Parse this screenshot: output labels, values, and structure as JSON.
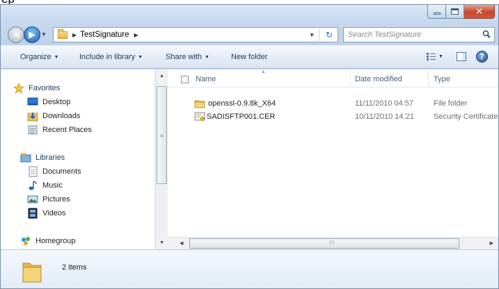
{
  "window": {
    "title": "TestSignature",
    "caption_buttons": [
      "minimize",
      "maximize",
      "close"
    ]
  },
  "address": {
    "crumbs": [
      "TestSignature"
    ],
    "folder_icon": "folder-icon"
  },
  "search": {
    "placeholder": "Search TestSignature"
  },
  "commandbar": {
    "organize": "Organize",
    "include_in_library": "Include in library",
    "share_with": "Share with",
    "new_folder": "New folder"
  },
  "navpane": {
    "favorites_header": "Favorites",
    "favorites": [
      "Desktop",
      "Downloads",
      "Recent Places"
    ],
    "libraries_header": "Libraries",
    "libraries": [
      "Documents",
      "Music",
      "Pictures",
      "Videos"
    ],
    "homegroup": "Homegroup"
  },
  "columns": {
    "name": "Name",
    "date_modified": "Date modified",
    "type": "Type"
  },
  "files": [
    {
      "name": "openssl-0.9.8k_X64",
      "date": "11/11/2010 04:57",
      "type": "File folder",
      "icon": "folder-icon"
    },
    {
      "name": "SADISFTP001.CER",
      "date": "10/11/2010 14:21",
      "type": "Security Certificate",
      "icon": "certificate-icon"
    }
  ],
  "details": {
    "item_count": "2 items"
  },
  "colors": {
    "frame": "#c9d9ed",
    "accent": "#1e395b",
    "close": "#c8462c"
  }
}
